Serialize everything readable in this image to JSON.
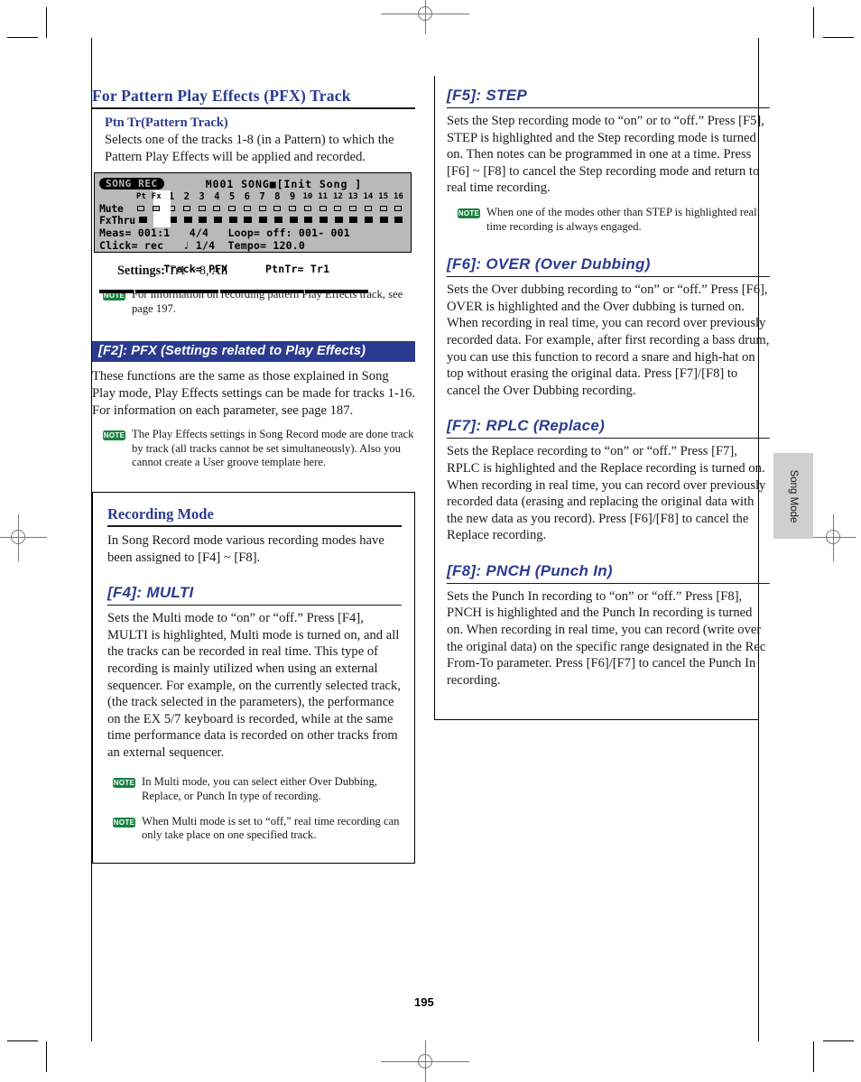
{
  "page": {
    "folio": "195",
    "side_tab": "Song Mode"
  },
  "left_column": {
    "section1": {
      "heading": "For Pattern Play Effects (PFX) Track",
      "sub_heading": "Ptn Tr(Pattern Track)",
      "body": "Selects one of the tracks 1-8 (in a Pattern) to which the Pattern Play Effects will be applied and recorded.",
      "settings_label": "Settings:",
      "settings_value": "Tr1 ~ 8, All",
      "note": "For information on recording pattern Play Effects track, see page 197."
    },
    "lcd": {
      "mode_pill": "SONG REC",
      "title_right": "M001 SONG■[Init Song ]",
      "track_headers": [
        "Pt",
        "Fx",
        "1",
        "2",
        "3",
        "4",
        "5",
        "6",
        "7",
        "8",
        "9",
        "10",
        "11",
        "12",
        "13",
        "14",
        "15",
        "16"
      ],
      "row_mute_label": "Mute",
      "row_fxthru_label": "FxThru",
      "line_meas": "Meas= 001:1   4/4   Loop= off: 001- 001",
      "line_click": "Click= rec   ♩ 1/4  Tempo= 120.0",
      "line_track_label": "Track= PFX",
      "line_track_highlight": "PtnTr= Tr1"
    },
    "section2": {
      "heading_bar": "[F2]: PFX (Settings related to Play Effects)",
      "body": "These functions are the same as those explained in Song Play mode, Play Effects settings can be made for tracks 1-16. For information on each parameter, see page 187.",
      "note": "The Play Effects settings in Song Record mode are done track by track (all tracks cannot be set simultaneously). Also you cannot create a User groove template here."
    },
    "recording_box": {
      "heading": "Recording Mode",
      "body": "In Song Record mode various recording modes have been assigned to [F4] ~ [F8].",
      "f4_heading": "[F4]: MULTI",
      "f4_body": "Sets the Multi mode to “on” or “off.” Press [F4], MULTI is highlighted, Multi mode is turned on, and all the tracks can be recorded in real time. This type of recording is mainly utilized when using an external sequencer. For example, on the currently selected track, (the track selected in the parameters), the performance on the EX 5/7 keyboard is recorded, while at the same time performance data is recorded on other tracks from an external sequencer.",
      "note1": "In Multi mode, you can select either Over Dubbing, Replace, or Punch In type of recording.",
      "note2": "When Multi mode is set to “off,” real time recording can only take place on one specified track."
    }
  },
  "right_column": {
    "f5": {
      "heading": "[F5]: STEP",
      "body": "Sets the Step recording mode to “on” or to “off.” Press [F5], STEP is highlighted and the Step recording mode is turned on. Then notes can be programmed in one at a time. Press [F6] ~ [F8] to cancel the Step recording mode and return to real time recording.",
      "note": "When one of the modes other than STEP is highlighted real time recording is always engaged."
    },
    "f6": {
      "heading": "[F6]: OVER (Over Dubbing)",
      "body": "Sets the Over dubbing recording to “on” or “off.” Press [F6], OVER is highlighted and the Over dubbing is turned on. When recording in real time, you can record over previously recorded data. For example, after first recording a bass drum, you can use this function to record a snare and high-hat on top without erasing the original data. Press [F7]/[F8] to cancel the Over Dubbing recording."
    },
    "f7": {
      "heading": "[F7]: RPLC (Replace)",
      "body": "Sets the Replace recording to “on” or “off.” Press [F7], RPLC is highlighted and the Replace recording is turned on. When recording in real time, you can record over previously recorded data (erasing and replacing the original data with the new data as you record). Press [F6]/[F8] to cancel the Replace recording."
    },
    "f8": {
      "heading": "[F8]: PNCH (Punch In)",
      "body": "Sets the Punch In recording to “on” or “off.” Press [F8], PNCH is highlighted and the Punch In recording is turned on. When recording in real time, you can record (write over the original data) on the specific range designated in the Rec From-To parameter. Press [F6]/[F7] to cancel the Punch In recording."
    }
  },
  "note_badge_label": "NOTE",
  "colors": {
    "heading_blue": "#2a3b8f",
    "note_green": "#17823f",
    "lcd_gray": "#b9b9b9"
  }
}
